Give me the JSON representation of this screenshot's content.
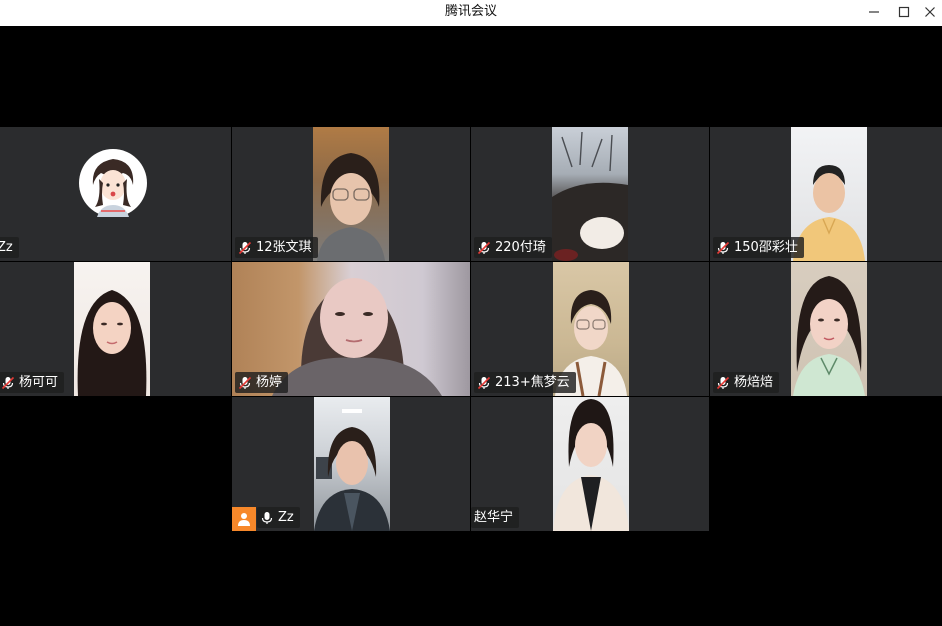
{
  "window": {
    "title": "腾讯会议"
  },
  "participants": [
    {
      "name": "Zz"
    },
    {
      "name": "12张文琪"
    },
    {
      "name": "220付琦"
    },
    {
      "name": "150邵彩壮"
    },
    {
      "name": "杨可可"
    },
    {
      "name": "杨婷"
    },
    {
      "name": "213+焦梦云"
    },
    {
      "name": "杨焙焙"
    },
    {
      "name": "Zz"
    },
    {
      "name": "赵华宁"
    }
  ],
  "icons": {
    "minimize": "minimize-icon",
    "maximize": "maximize-icon",
    "close": "close-icon",
    "mic_muted": "mic-muted-icon",
    "mic": "mic-icon",
    "host": "host-person-icon"
  },
  "colors": {
    "tile_bg": "#2b2c2e",
    "host_badge": "#f7882a",
    "muted_red": "#e53935"
  }
}
